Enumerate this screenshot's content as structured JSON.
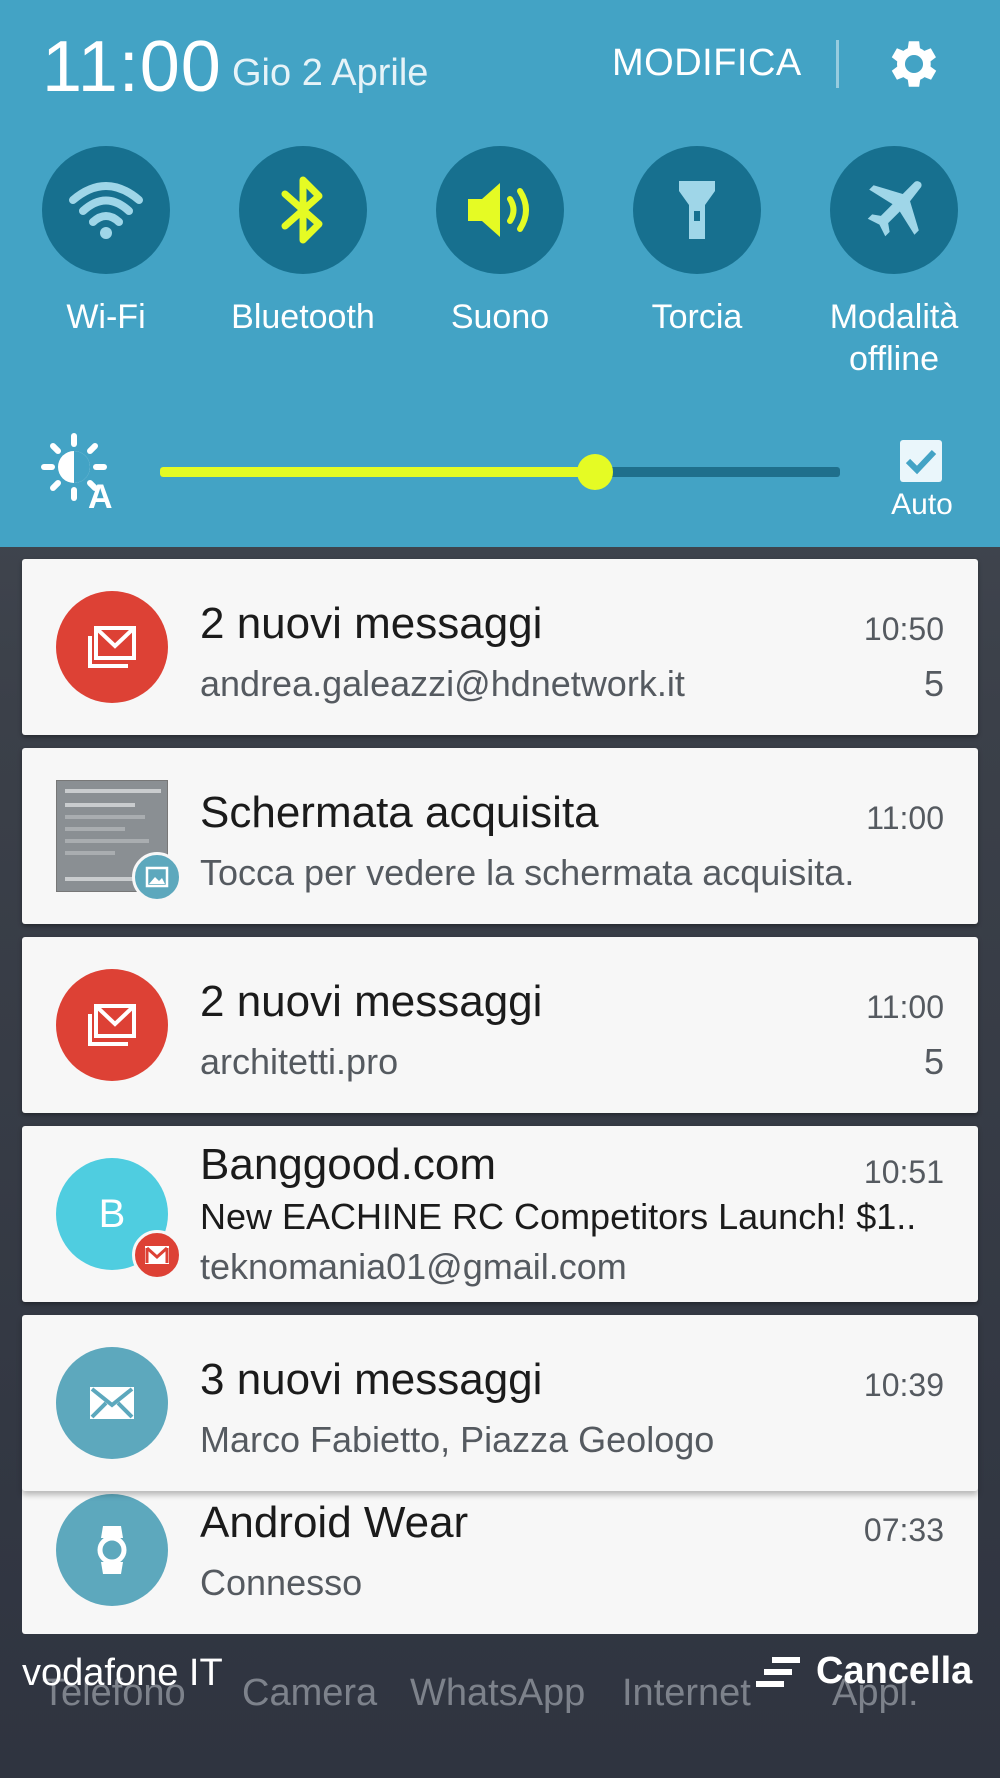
{
  "panel": {
    "time": "11:00",
    "date": "Gio 2 Aprile",
    "edit_label": "MODIFICA",
    "bg_color": "#43a3c5",
    "toggles": [
      {
        "label": "Wi-Fi",
        "icon": "wifi-icon",
        "active": false
      },
      {
        "label": "Bluetooth",
        "icon": "bluetooth-icon",
        "active": true
      },
      {
        "label": "Suono",
        "icon": "speaker-icon",
        "active": true
      },
      {
        "label": "Torcia",
        "icon": "flashlight-icon",
        "active": false
      },
      {
        "label_line1": "Modalità",
        "label_line2": "offline",
        "icon": "airplane-icon",
        "active": false
      }
    ],
    "brightness": {
      "level": 0.64,
      "auto_label": "Auto",
      "auto_checked": true
    },
    "accent_color": "#e5fb24"
  },
  "notifications": [
    {
      "title": "2 nuovi messaggi",
      "text": "andrea.galeazzi@hdnetwork.it",
      "time": "10:50",
      "count": "5",
      "icon": "mail-stack-icon",
      "icon_color": "#dd4135"
    },
    {
      "title": "Schermata acquisita",
      "text": "Tocca per vedere la schermata acquisita.",
      "time": "11:00",
      "icon": "screenshot-thumbnail",
      "badge_icon": "image-icon"
    },
    {
      "title": "2 nuovi messaggi",
      "text": "architetti.pro",
      "time": "11:00",
      "count": "5",
      "icon": "mail-stack-icon",
      "icon_color": "#dd4135"
    },
    {
      "title": "Banggood.com",
      "text": "New EACHINE RC Competitors Launch! $1..",
      "subtext": "teknomania01@gmail.com",
      "time": "10:51",
      "avatar_letter": "B",
      "icon_color": "#4fcde0",
      "badge_icon": "gmail-icon"
    },
    {
      "title": "3 nuovi messaggi",
      "text": "Marco Fabietto, Piazza Geologo",
      "time": "10:39",
      "icon": "envelope-icon",
      "icon_color": "#5da8bd"
    },
    {
      "title": "Android Wear",
      "text": "Connesso",
      "time": "07:33",
      "icon": "watch-icon",
      "icon_color": "#5da8bd"
    }
  ],
  "footer": {
    "carrier": "vodafone IT",
    "clear_label": "Cancella",
    "dock_apps": [
      "Telefono",
      "Camera",
      "WhatsApp",
      "Internet",
      "Appl."
    ]
  }
}
